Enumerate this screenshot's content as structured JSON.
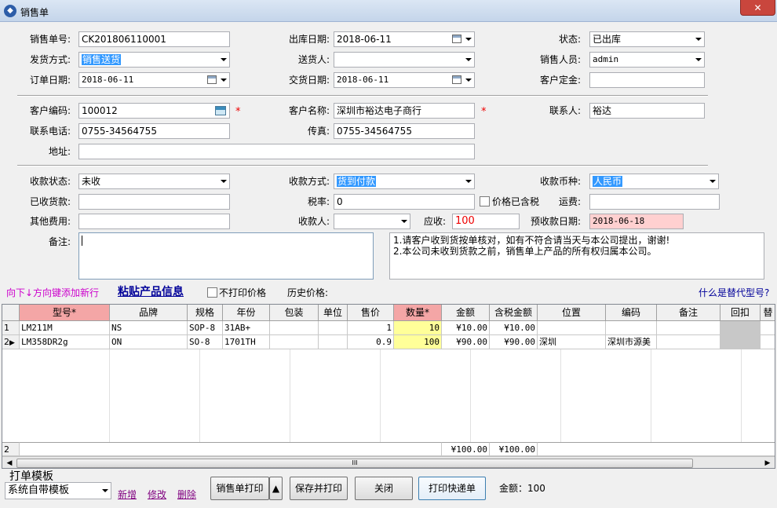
{
  "window": {
    "title": "销售单",
    "close": "✕"
  },
  "form": {
    "order_no_label": "销售单号:",
    "order_no": "CK201806110001",
    "out_date_label": "出库日期:",
    "out_date": "2018-06-11",
    "status_label": "状态:",
    "status": "已出库",
    "ship_method_label": "发货方式:",
    "ship_method": "销售送货",
    "deliverer_label": "送货人:",
    "deliverer": "",
    "salesman_label": "销售人员:",
    "salesman": "admin",
    "order_date_label": "订单日期:",
    "order_date": "2018-06-11",
    "delivery_date_label": "交货日期:",
    "delivery_date": "2018-06-11",
    "deposit_label": "客户定金:",
    "deposit": "",
    "customer_code_label": "客户编码:",
    "customer_code": "100012",
    "customer_name_label": "客户名称:",
    "customer_name": "深圳市裕达电子商行",
    "contact_label": "联系人:",
    "contact": "裕达",
    "phone_label": "联系电话:",
    "phone": "0755-34564755",
    "fax_label": "传真:",
    "fax": "0755-34564755",
    "address_label": "地址:",
    "address": "",
    "pay_status_label": "收款状态:",
    "pay_status": "未收",
    "pay_method_label": "收款方式:",
    "pay_method": "货到付款",
    "currency_label": "收款币种:",
    "currency": "人民币",
    "received_label": "已收货款:",
    "received": "",
    "tax_rate_label": "税率:",
    "tax_rate": "0",
    "tax_included_label": "价格已含税",
    "freight_label": "运费:",
    "freight": "",
    "other_fee_label": "其他费用:",
    "other_fee": "",
    "payee_label": "收款人:",
    "payee": "",
    "receivable_label": "应收:",
    "receivable": "100",
    "expected_date_label": "预收款日期:",
    "expected_date": "2018-06-18",
    "remark_label": "备注:",
    "remark": "",
    "note_line1": "1.请客户收到货按单核对，如有不符合请当天与本公司提出，谢谢!",
    "note_line2": "2.本公司未收到货款之前，销售单上产品的所有权归属本公司。",
    "required_mark": "*"
  },
  "toolbar": {
    "add_row_hint": "向下↓方向键添加新行",
    "paste_link": "粘贴产品信息",
    "no_print_price": "不打印价格",
    "history_price": "历史价格:",
    "alt_model_link": "什么是替代型号?"
  },
  "grid": {
    "headers": [
      "型号*",
      "品牌",
      "规格",
      "年份",
      "包装",
      "单位",
      "售价",
      "数量*",
      "金额",
      "含税金额",
      "位置",
      "编码",
      "备注",
      "回扣",
      "替"
    ],
    "rows": [
      {
        "num": "1",
        "model": "LM211M",
        "brand": "NS",
        "spec": "SOP-8",
        "year": "31AB+",
        "pack": "",
        "unit": "",
        "price": "1",
        "qty": "10",
        "amount": "¥10.00",
        "tax_amount": "¥10.00",
        "location": "",
        "code": "",
        "remark": ""
      },
      {
        "num": "2",
        "model": "LM358DR2g",
        "brand": "ON",
        "spec": "SO-8",
        "year": "1701TH",
        "pack": "",
        "unit": "",
        "price": "0.9",
        "qty": "100",
        "amount": "¥90.00",
        "tax_amount": "¥90.00",
        "location": "深圳",
        "code": "深圳市源美",
        "remark": ""
      }
    ],
    "footer": {
      "count": "2",
      "amount": "¥100.00",
      "tax_amount": "¥100.00"
    },
    "scroll_grip": "III"
  },
  "bottom": {
    "template_title": "打单模板",
    "template_value": "系统自带模板",
    "new_link": "新增",
    "edit_link": "修改",
    "delete_link": "删除",
    "print_btn": "销售单打印",
    "print_arrow": "▲",
    "save_print_btn": "保存并打印",
    "close_btn": "关闭",
    "express_btn": "打印快递单",
    "total_label": "金额：",
    "total_value": "100"
  },
  "colors": {
    "highlight": "#3399ff",
    "qty_col": "#ffff99",
    "model_header": "#f4a6a6",
    "date_pink": "#ffd0d0",
    "link_blue": "#000099",
    "purple": "#cc00cc"
  }
}
